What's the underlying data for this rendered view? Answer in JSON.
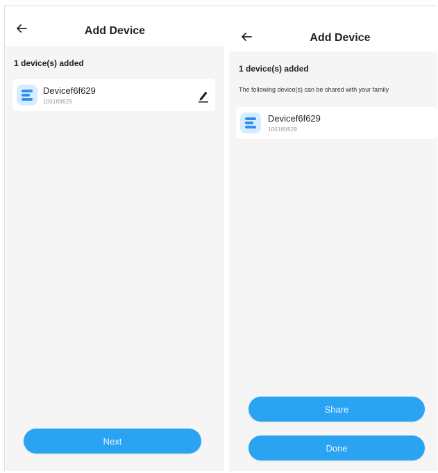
{
  "colors": {
    "accent": "#2aa3f3",
    "icon_bg": "#d7ecff",
    "icon_fg": "#2f8df0"
  },
  "left_screen": {
    "header": {
      "title": "Add Device",
      "back_icon": "arrow-left-icon"
    },
    "count_label": "1 device(s) added",
    "device": {
      "name": "Devicef6f629",
      "id": "1001f6f629",
      "icon": "device-list-icon",
      "edit_icon": "pencil-icon"
    },
    "next_label": "Next"
  },
  "right_screen": {
    "header": {
      "title": "Add Device",
      "back_icon": "arrow-left-icon"
    },
    "count_label": "1 device(s) added",
    "share_note": "The following device(s) can be shared with your family",
    "device": {
      "name": "Devicef6f629",
      "id": "1001f6f629",
      "icon": "device-list-icon"
    },
    "share_label": "Share",
    "done_label": "Done"
  }
}
